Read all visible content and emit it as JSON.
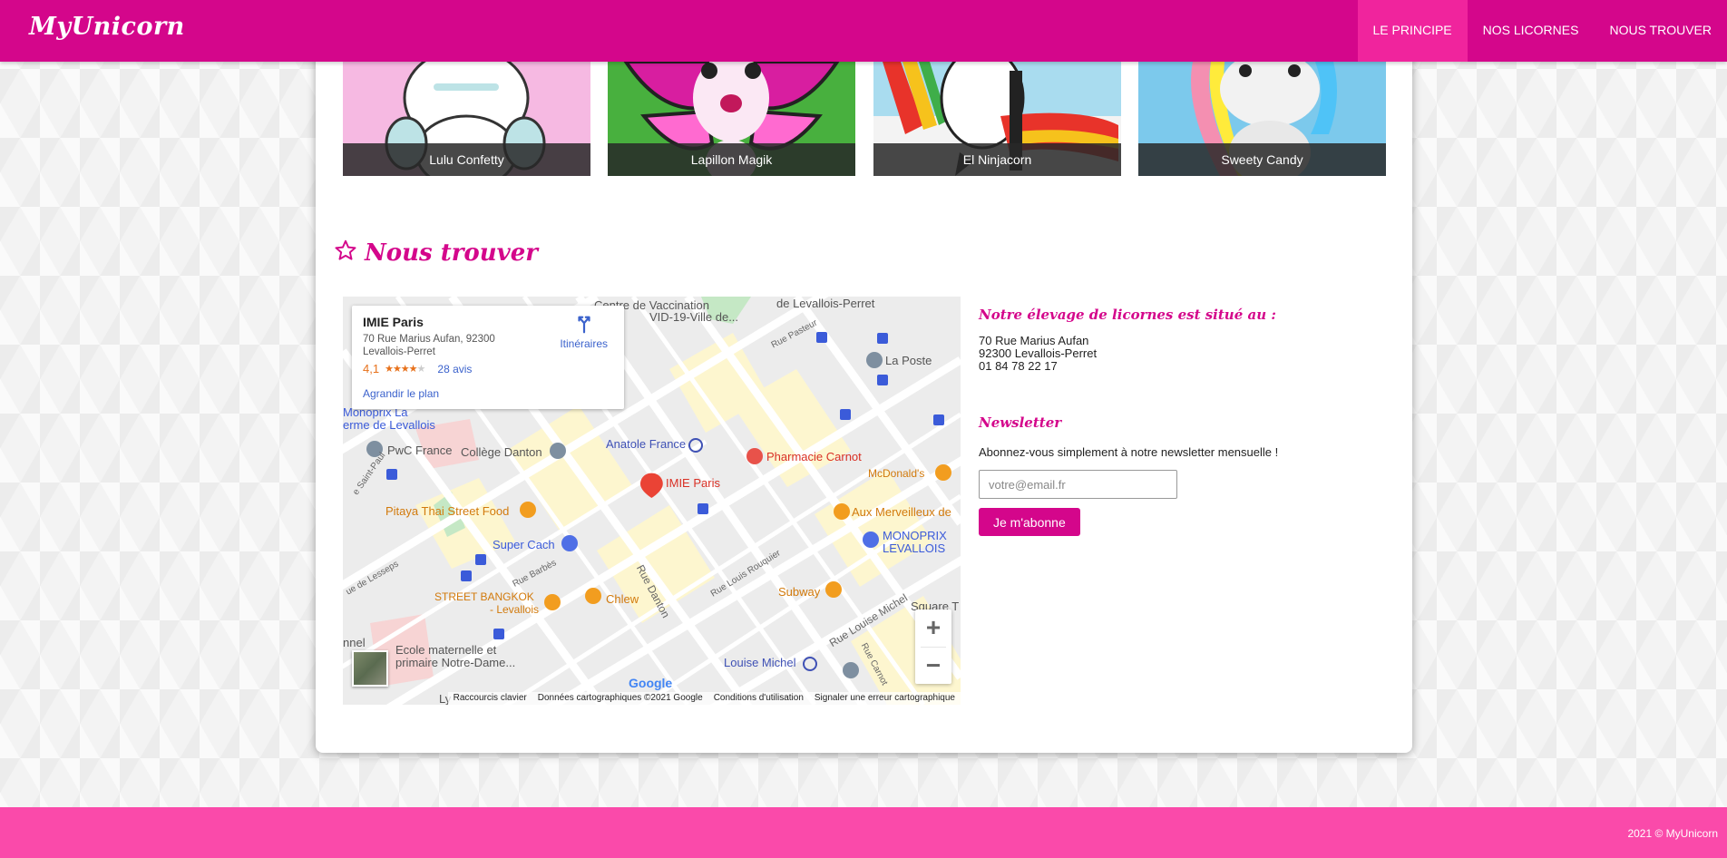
{
  "navbar": {
    "brand": "MyUnicorn",
    "links": [
      "LE PRINCIPE",
      "NOS LICORNES",
      "NOUS TROUVER"
    ],
    "active_index": 0,
    "colors": {
      "bar": "#d4068b",
      "active": "#f0249d"
    }
  },
  "unicorns": [
    {
      "name": "Lulu Confetty"
    },
    {
      "name": "Lapillon Magik"
    },
    {
      "name": "El Ninjacorn"
    },
    {
      "name": "Sweety Candy"
    }
  ],
  "find_us": {
    "title": "Nous trouver",
    "icon": "star-outline-icon"
  },
  "map": {
    "place_name": "IMIE Paris",
    "address": "70 Rue Marius Aufan, 92300 Levallois-Perret",
    "rating": "4,1",
    "stars_filled": 4,
    "reviews": "28 avis",
    "directions": "Itinéraires",
    "enlarge": "Agrandir le plan",
    "zoom_in": "+",
    "zoom_out": "−",
    "google_logo": "Google",
    "attribution": [
      "Raccourcis clavier",
      "Données cartographiques ©2021 Google",
      "Conditions d'utilisation",
      "Signaler une erreur cartographique"
    ],
    "labels": {
      "vaccination": "Centre de Vaccination",
      "vaccination2": "VID-19-Ville de...",
      "levallois_perret": "de Levallois-Perret",
      "rue_pasteur": "Rue Pasteur",
      "la_poste": "La Poste",
      "monoprix_la": "Monoprix La",
      "ferme": "erme de Levallois",
      "pwc": "PwC France",
      "college": "Collège Danton",
      "anatole": "Anatole France",
      "pharmacie": "Pharmacie Carnot",
      "mcdonalds": "McDonald's",
      "imie": "IMIE Paris",
      "pitaya": "Pitaya Thai Street Food",
      "merveilleux": "Aux Merveilleux de",
      "monoprix_levallois": "MONOPRIX",
      "monoprix_levallois2": "LEVALLOIS",
      "super_cach": "Super Cach",
      "saint_paul": "e Saint-Paul",
      "rue_barbes": "Rue Barbès",
      "lesseps": "ue de Lesseps",
      "street_bangkok": "STREET BANGKOK",
      "street_bangkok2": "- Levallois",
      "chlew": "Chlew",
      "rue_danton": "Rue Danton",
      "rue_rouquier": "Rue Louis Rouquier",
      "subway": "Subway",
      "rue_louise_michel": "Rue Louise Michel",
      "rue_carnot": "Rue Carnot",
      "square": "Square T",
      "ecole": "Ecole maternelle et",
      "ecole2": "primaire Notre-Dame...",
      "louise_michel": "Louise Michel",
      "nnel": "nnel",
      "ly": "Ly"
    }
  },
  "address_block": {
    "heading": "Notre élevage de licornes est situé au :",
    "lines": [
      "70 Rue Marius Aufan",
      "92300 Levallois-Perret",
      "01 84 78 22 17"
    ]
  },
  "newsletter": {
    "heading": "Newsletter",
    "text": "Abonnez-vous simplement à notre newsletter mensuelle !",
    "placeholder": "votre@email.fr",
    "button": "Je m'abonne"
  },
  "footer": {
    "text": "2021 © MyUnicorn",
    "color": "#fa4aaa"
  }
}
